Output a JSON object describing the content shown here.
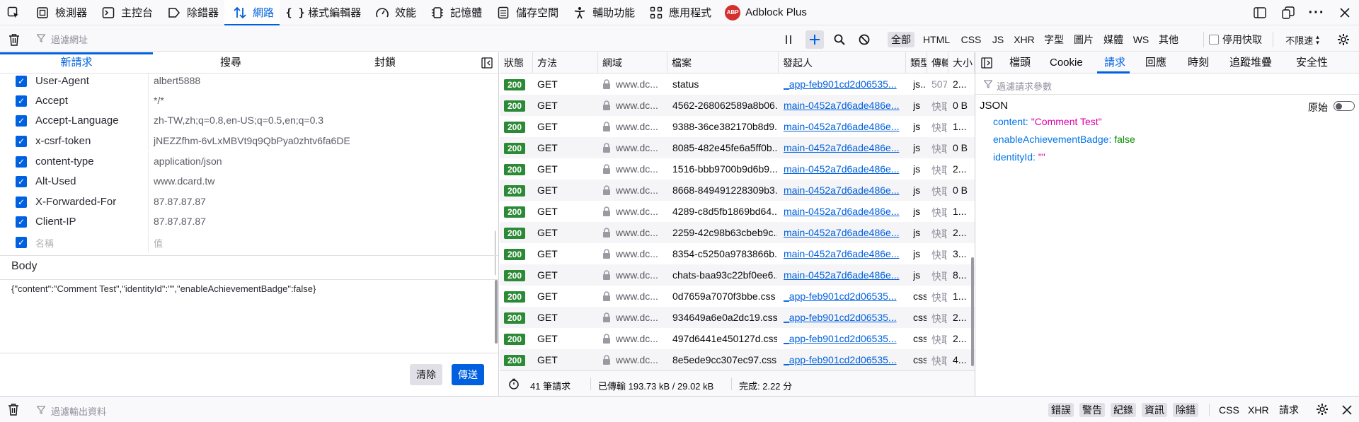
{
  "toolbar": {
    "tabs": [
      {
        "label": "檢測器",
        "icon": "inspector-icon"
      },
      {
        "label": "主控台",
        "icon": "console-icon"
      },
      {
        "label": "除錯器",
        "icon": "debugger-icon"
      },
      {
        "label": "網路",
        "icon": "network-icon"
      },
      {
        "label": "樣式編輯器",
        "icon": "style-editor-icon"
      },
      {
        "label": "效能",
        "icon": "performance-icon"
      },
      {
        "label": "記憶體",
        "icon": "memory-icon"
      },
      {
        "label": "儲存空間",
        "icon": "storage-icon"
      },
      {
        "label": "輔助功能",
        "icon": "accessibility-icon"
      },
      {
        "label": "應用程式",
        "icon": "application-icon"
      },
      {
        "label": "Adblock Plus",
        "icon": "adblock-icon"
      }
    ],
    "adblock_badge": "ABP"
  },
  "net_toolbar": {
    "filter_placeholder": "過濾網址",
    "types": [
      "全部",
      "HTML",
      "CSS",
      "JS",
      "XHR",
      "字型",
      "圖片",
      "媒體",
      "WS",
      "其他"
    ],
    "disable_cache_label": "停用快取",
    "throttle_label": "不限速"
  },
  "left_pane": {
    "tabs": [
      "新請求",
      "搜尋",
      "封鎖"
    ],
    "headers": [
      {
        "name": "User-Agent",
        "value": "albert5888"
      },
      {
        "name": "Accept",
        "value": "*/*"
      },
      {
        "name": "Accept-Language",
        "value": "zh-TW,zh;q=0.8,en-US;q=0.5,en;q=0.3"
      },
      {
        "name": "x-csrf-token",
        "value": "jNEZZfhm-6vLxMBVt9q9QbPya0zhtv6fa6DE"
      },
      {
        "name": "content-type",
        "value": "application/json"
      },
      {
        "name": "Alt-Used",
        "value": "www.dcard.tw"
      },
      {
        "name": "X-Forwarded-For",
        "value": "87.87.87.87"
      },
      {
        "name": "Client-IP",
        "value": "87.87.87.87"
      }
    ],
    "new_name_placeholder": "名稱",
    "new_value_placeholder": "值",
    "body_label": "Body",
    "body_value": "{\"content\":\"Comment Test\",\"identityId\":\"\",\"enableAchievementBadge\":false}",
    "clear_label": "清除",
    "send_label": "傳送"
  },
  "table": {
    "columns": [
      "狀態",
      "方法",
      "網域",
      "檔案",
      "發起人",
      "類型",
      "傳輸",
      "大小"
    ],
    "rows": [
      {
        "status": "200",
        "method": "GET",
        "domain": "www.dc...",
        "file": "status",
        "initiator": "_app-feb901cd2d06535...",
        "type": "js...",
        "transfer": "507...",
        "size": "2..."
      },
      {
        "status": "200",
        "method": "GET",
        "domain": "www.dc...",
        "file": "4562-268062589a8b06...",
        "initiator": "main-0452a7d6ade486e...",
        "type": "js",
        "transfer": "快取",
        "size": "0 B"
      },
      {
        "status": "200",
        "method": "GET",
        "domain": "www.dc...",
        "file": "9388-36ce382170b8d9...",
        "initiator": "main-0452a7d6ade486e...",
        "type": "js",
        "transfer": "快取",
        "size": "1..."
      },
      {
        "status": "200",
        "method": "GET",
        "domain": "www.dc...",
        "file": "8085-482e45fe6a5ff0b...",
        "initiator": "main-0452a7d6ade486e...",
        "type": "js",
        "transfer": "快取",
        "size": "0 B"
      },
      {
        "status": "200",
        "method": "GET",
        "domain": "www.dc...",
        "file": "1516-bbb9700b9d6b9...",
        "initiator": "main-0452a7d6ade486e...",
        "type": "js",
        "transfer": "快取",
        "size": "2..."
      },
      {
        "status": "200",
        "method": "GET",
        "domain": "www.dc...",
        "file": "8668-849491228309b3...",
        "initiator": "main-0452a7d6ade486e...",
        "type": "js",
        "transfer": "快取",
        "size": "0 B"
      },
      {
        "status": "200",
        "method": "GET",
        "domain": "www.dc...",
        "file": "4289-c8d5fb1869bd64...",
        "initiator": "main-0452a7d6ade486e...",
        "type": "js",
        "transfer": "快取",
        "size": "1..."
      },
      {
        "status": "200",
        "method": "GET",
        "domain": "www.dc...",
        "file": "2259-42c98b63cbeb9c...",
        "initiator": "main-0452a7d6ade486e...",
        "type": "js",
        "transfer": "快取",
        "size": "2..."
      },
      {
        "status": "200",
        "method": "GET",
        "domain": "www.dc...",
        "file": "8354-c5250a9783866b...",
        "initiator": "main-0452a7d6ade486e...",
        "type": "js",
        "transfer": "快取",
        "size": "3..."
      },
      {
        "status": "200",
        "method": "GET",
        "domain": "www.dc...",
        "file": "chats-baa93c22bf0ee6...",
        "initiator": "main-0452a7d6ade486e...",
        "type": "js",
        "transfer": "快取",
        "size": "8..."
      },
      {
        "status": "200",
        "method": "GET",
        "domain": "www.dc...",
        "file": "0d7659a7070f3bbe.css",
        "initiator": "_app-feb901cd2d06535...",
        "type": "css",
        "transfer": "快取",
        "size": "1..."
      },
      {
        "status": "200",
        "method": "GET",
        "domain": "www.dc...",
        "file": "934649a6e0a2dc19.css",
        "initiator": "_app-feb901cd2d06535...",
        "type": "css",
        "transfer": "快取",
        "size": "2..."
      },
      {
        "status": "200",
        "method": "GET",
        "domain": "www.dc...",
        "file": "497d6441e450127d.css",
        "initiator": "_app-feb901cd2d06535...",
        "type": "css",
        "transfer": "快取",
        "size": "2..."
      },
      {
        "status": "200",
        "method": "GET",
        "domain": "www.dc...",
        "file": "8e5ede9cc307ec97.css",
        "initiator": "_app-feb901cd2d06535...",
        "type": "css",
        "transfer": "快取",
        "size": "4..."
      }
    ]
  },
  "summary": {
    "requests": "41 筆請求",
    "transferred": "已傳輸 193.73 kB / 29.02 kB",
    "finished": "完成: 2.22 分"
  },
  "details": {
    "tabs": [
      "檔頭",
      "Cookie",
      "請求",
      "回應",
      "時刻",
      "追蹤堆疊",
      "安全性"
    ],
    "filter_placeholder": "過濾請求參數",
    "json_label": "JSON",
    "raw_label": "原始",
    "entries": [
      {
        "key": "content:",
        "value": "\"Comment Test\"",
        "kind": "str"
      },
      {
        "key": "enableAchievementBadge:",
        "value": "false",
        "kind": "bool"
      },
      {
        "key": "identityId:",
        "value": "\"\"",
        "kind": "str"
      }
    ]
  },
  "console": {
    "filter_placeholder": "過濾輸出資料",
    "levels": [
      "錯誤",
      "警告",
      "紀錄",
      "資訊",
      "除錯"
    ],
    "types": [
      "CSS",
      "XHR",
      "請求"
    ]
  },
  "colors": {
    "accent": "#0061e0",
    "status_ok": "#2c8a37",
    "send_button": "#0060df"
  }
}
